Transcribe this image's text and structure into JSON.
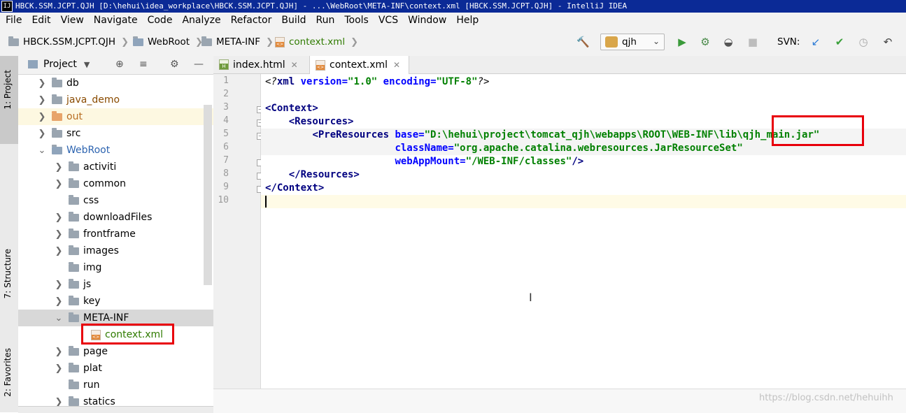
{
  "window": {
    "title": "HBCK.SSM.JCPT.QJH [D:\\hehui\\idea_workplace\\HBCK.SSM.JCPT.QJH] - ...\\WebRoot\\META-INF\\context.xml [HBCK.SSM.JCPT.QJH] - IntelliJ IDEA",
    "logo": "IJ"
  },
  "menu": [
    "File",
    "Edit",
    "View",
    "Navigate",
    "Code",
    "Analyze",
    "Refactor",
    "Build",
    "Run",
    "Tools",
    "VCS",
    "Window",
    "Help"
  ],
  "breadcrumb": [
    "HBCK.SSM.JCPT.QJH",
    "WebRoot",
    "META-INF",
    "context.xml"
  ],
  "toolbar": {
    "run_config": "qjh",
    "svn_label": "SVN:",
    "icons": [
      "hammer-icon",
      "run-icon",
      "debug-icon",
      "coverage-icon",
      "stop-icon",
      "svn-update-icon",
      "svn-commit-icon",
      "history-icon",
      "rollback-icon"
    ]
  },
  "project_panel": {
    "title": "Project",
    "tree": [
      {
        "label": "db",
        "level": 0,
        "arrow": "collapsed",
        "icon": "folder"
      },
      {
        "label": "java_demo",
        "level": 0,
        "arrow": "collapsed",
        "icon": "folder"
      },
      {
        "label": "out",
        "level": 0,
        "arrow": "collapsed",
        "icon": "folder-excluded"
      },
      {
        "label": "src",
        "level": 0,
        "arrow": "collapsed",
        "icon": "folder"
      },
      {
        "label": "WebRoot",
        "level": 0,
        "arrow": "expanded",
        "icon": "folder-web"
      },
      {
        "label": "activiti",
        "level": 1,
        "arrow": "collapsed",
        "icon": "folder"
      },
      {
        "label": "common",
        "level": 1,
        "arrow": "collapsed",
        "icon": "folder"
      },
      {
        "label": "css",
        "level": 1,
        "arrow": "none",
        "icon": "folder"
      },
      {
        "label": "downloadFiles",
        "level": 1,
        "arrow": "collapsed",
        "icon": "folder"
      },
      {
        "label": "frontframe",
        "level": 1,
        "arrow": "collapsed",
        "icon": "folder"
      },
      {
        "label": "images",
        "level": 1,
        "arrow": "collapsed",
        "icon": "folder"
      },
      {
        "label": "img",
        "level": 1,
        "arrow": "none",
        "icon": "folder"
      },
      {
        "label": "js",
        "level": 1,
        "arrow": "collapsed",
        "icon": "folder"
      },
      {
        "label": "key",
        "level": 1,
        "arrow": "collapsed",
        "icon": "folder"
      },
      {
        "label": "META-INF",
        "level": 1,
        "arrow": "expanded",
        "icon": "folder"
      },
      {
        "label": "context.xml",
        "level": 2,
        "arrow": "none",
        "icon": "xml-file"
      },
      {
        "label": "page",
        "level": 1,
        "arrow": "collapsed",
        "icon": "folder"
      },
      {
        "label": "plat",
        "level": 1,
        "arrow": "collapsed",
        "icon": "folder"
      },
      {
        "label": "run",
        "level": 1,
        "arrow": "none",
        "icon": "folder"
      },
      {
        "label": "statics",
        "level": 1,
        "arrow": "collapsed",
        "icon": "folder"
      }
    ]
  },
  "left_tool_tabs": [
    "1: Project",
    "7: Structure",
    "2: Favorites"
  ],
  "editor": {
    "tabs": [
      {
        "label": "index.html",
        "active": false
      },
      {
        "label": "context.xml",
        "active": true
      }
    ],
    "line_numbers": [
      "1",
      "2",
      "3",
      "4",
      "5",
      "6",
      "7",
      "8",
      "9",
      "10"
    ],
    "lines": {
      "l1": {
        "open": "<?",
        "name": "xml",
        "a1": "version",
        "v1": "\"1.0\"",
        "a2": "encoding",
        "v2": "\"UTF-8\"",
        "close": "?>"
      },
      "l3": "<Context>",
      "l4": "<Resources>",
      "l5": {
        "tag": "<PreResources",
        "attr": "base",
        "eq": "=",
        "value": "\"D:\\hehui\\project\\tomcat_qjh\\webapps\\ROOT\\WEB-INF\\lib\\qjh_main.jar\""
      },
      "l6": {
        "attr": "className",
        "eq": "=",
        "value": "\"org.apache.catalina.webresources.JarResourceSet\""
      },
      "l7": {
        "attr": "webAppMount",
        "eq": "=",
        "value": "\"/WEB-INF/classes\"",
        "close": "/>"
      },
      "l8": "</Resources>",
      "l9": "</Context>"
    }
  },
  "watermark": "https://blog.csdn.net/hehuihh",
  "colors": {
    "highlight_box": "#e8000b",
    "tag": "#000080",
    "attr": "#0000ff",
    "value": "#008000"
  }
}
